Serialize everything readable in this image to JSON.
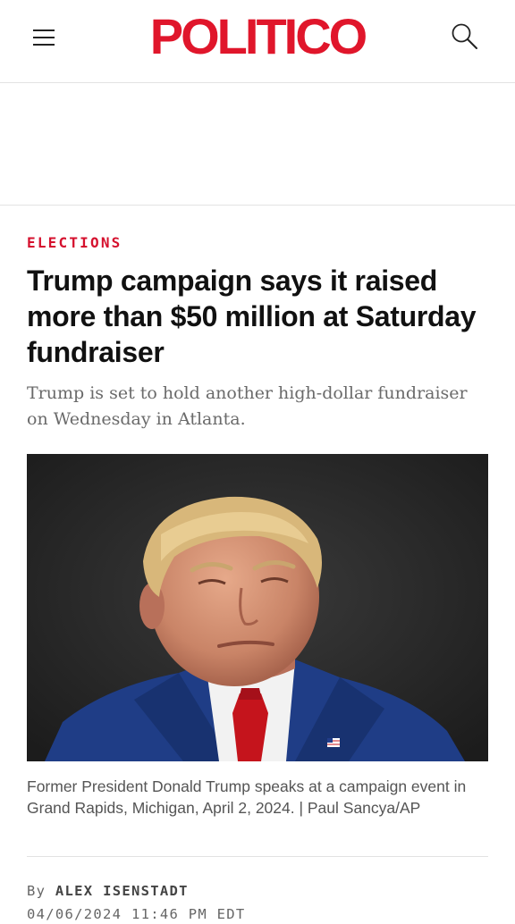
{
  "header": {
    "logo_text": "POLITICO",
    "brand_color": "#e0162b",
    "menu_icon": "hamburger-menu-icon",
    "search_icon": "search-icon"
  },
  "article": {
    "section": "ELECTIONS",
    "headline": "Trump campaign says it raised more than $50 million at Saturday fundraiser",
    "dek": "Trump is set to hold another high-dollar fundraiser on Wednesday in Atlanta.",
    "image_caption": "Former President Donald Trump speaks at a campaign event in Grand Rapids, Michigan, April 2, 2024. | Paul Sancya/AP",
    "byline_prefix": "By",
    "author": "ALEX ISENSTADT",
    "timestamp": "04/06/2024 11:46 PM EDT"
  }
}
